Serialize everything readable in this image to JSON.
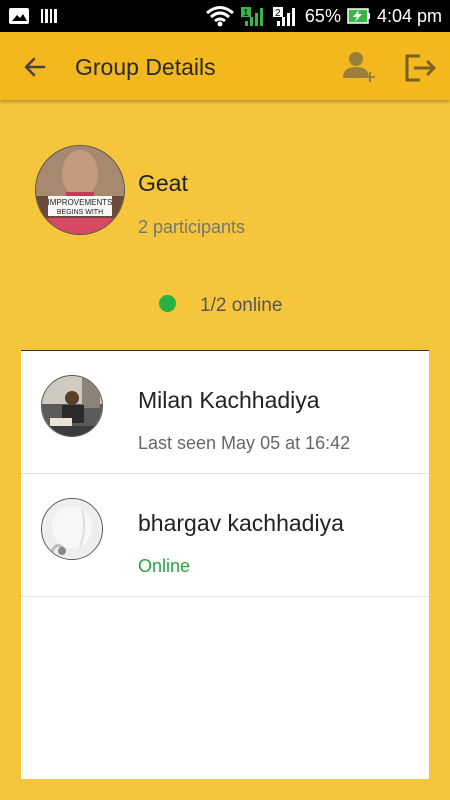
{
  "status_bar": {
    "battery": "65%",
    "time": "4:04 pm",
    "sim1": "1",
    "sim2": "2"
  },
  "app_bar": {
    "title": "Group Details"
  },
  "group": {
    "name": "Geat",
    "participants": "2 participants",
    "online": "1/2 online",
    "avatar_text_line1": "IMPROVEMENTS",
    "avatar_text_line2": "BEGINS WITH"
  },
  "members": [
    {
      "name": "Milan Kachhadiya",
      "status": "Last seen May 05 at 16:42",
      "online": false
    },
    {
      "name": "bhargav kachhadiya",
      "status": "Online",
      "online": true
    }
  ],
  "colors": {
    "background": "#F5C63C",
    "app_bar": "#F2B81E",
    "online_green": "#27B340"
  }
}
